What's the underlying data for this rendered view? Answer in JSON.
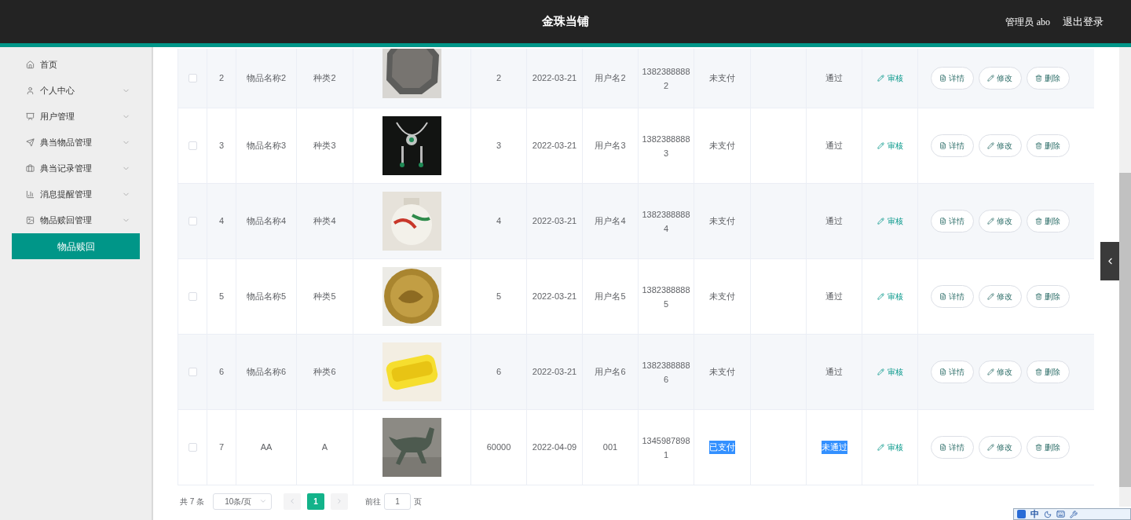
{
  "header": {
    "title": "金珠当铺",
    "user_label": "管理员",
    "username": "abo",
    "logout": "退出登录"
  },
  "sidebar": {
    "items": [
      {
        "label": "首页",
        "expandable": false,
        "selected": false
      },
      {
        "label": "个人中心",
        "expandable": true,
        "selected": false
      },
      {
        "label": "用户管理",
        "expandable": true,
        "selected": false
      },
      {
        "label": "典当物品管理",
        "expandable": true,
        "selected": false
      },
      {
        "label": "典当记录管理",
        "expandable": true,
        "selected": false
      },
      {
        "label": "消息提醒管理",
        "expandable": true,
        "selected": false
      },
      {
        "label": "物品赎回管理",
        "expandable": true,
        "selected": false
      },
      {
        "label": "物品赎回",
        "expandable": false,
        "selected": true
      }
    ]
  },
  "table": {
    "rows": [
      {
        "checked": false,
        "index": "2",
        "name": "物品名称2",
        "type": "种类2",
        "amount": "2",
        "date": "2022-03-21",
        "user": "用户名2",
        "phone": "13823888882",
        "pay": {
          "text": "未支付",
          "highlighted": false
        },
        "review": {
          "text": "通过",
          "highlighted": false
        },
        "audit": "审核",
        "actions": [
          "详情",
          "修改",
          "删除"
        ]
      },
      {
        "checked": false,
        "index": "3",
        "name": "物品名称3",
        "type": "种类3",
        "amount": "3",
        "date": "2022-03-21",
        "user": "用户名3",
        "phone": "13823888883",
        "pay": {
          "text": "未支付",
          "highlighted": false
        },
        "review": {
          "text": "通过",
          "highlighted": false
        },
        "audit": "审核",
        "actions": [
          "详情",
          "修改",
          "删除"
        ]
      },
      {
        "checked": false,
        "index": "4",
        "name": "物品名称4",
        "type": "种类4",
        "amount": "4",
        "date": "2022-03-21",
        "user": "用户名4",
        "phone": "13823888884",
        "pay": {
          "text": "未支付",
          "highlighted": false
        },
        "review": {
          "text": "通过",
          "highlighted": false
        },
        "audit": "审核",
        "actions": [
          "详情",
          "修改",
          "删除"
        ]
      },
      {
        "checked": false,
        "index": "5",
        "name": "物品名称5",
        "type": "种类5",
        "amount": "5",
        "date": "2022-03-21",
        "user": "用户名5",
        "phone": "13823888885",
        "pay": {
          "text": "未支付",
          "highlighted": false
        },
        "review": {
          "text": "通过",
          "highlighted": false
        },
        "audit": "审核",
        "actions": [
          "详情",
          "修改",
          "删除"
        ]
      },
      {
        "checked": false,
        "index": "6",
        "name": "物品名称6",
        "type": "种类6",
        "amount": "6",
        "date": "2022-03-21",
        "user": "用户名6",
        "phone": "13823888886",
        "pay": {
          "text": "未支付",
          "highlighted": false
        },
        "review": {
          "text": "通过",
          "highlighted": false
        },
        "audit": "审核",
        "actions": [
          "详情",
          "修改",
          "删除"
        ]
      },
      {
        "checked": false,
        "index": "7",
        "name": "AA",
        "type": "A",
        "amount": "60000",
        "date": "2022-04-09",
        "user": "001",
        "phone": "13459878981",
        "pay": {
          "text": "已支付",
          "highlighted": true
        },
        "review": {
          "text": "未通过",
          "highlighted": true
        },
        "audit": "审核",
        "actions": [
          "详情",
          "修改",
          "删除"
        ]
      }
    ]
  },
  "pagination": {
    "total_prefix": "共",
    "total": "7",
    "total_suffix": "条",
    "page_size": "10条/页",
    "pages": [
      {
        "label": "1",
        "selected": true
      }
    ],
    "goto_label": "前往",
    "goto_value": "1",
    "goto_suffix": "页"
  },
  "ime_toolbar": {
    "mode": "中"
  }
}
